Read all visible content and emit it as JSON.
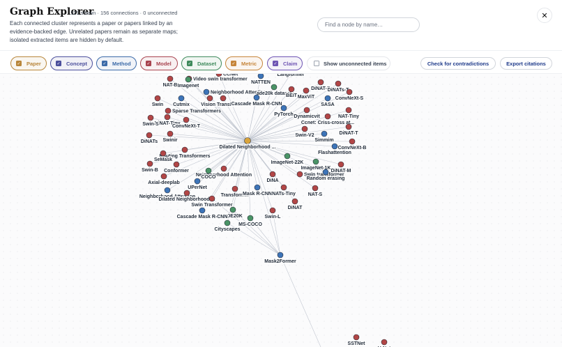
{
  "header": {
    "title": "Graph Explorer",
    "stats": "121 shown · 156 connections · 0 unconnected",
    "description": "Each connected cluster represents a paper or papers linked by an evidence-backed edge. Unrelated papers remain as separate maps; isolated extracted items are hidden by default.",
    "search_placeholder": "Find a node by name…",
    "close_icon": "close-icon"
  },
  "filters": [
    {
      "label": "Paper",
      "color": "#b8863b",
      "checked": true
    },
    {
      "label": "Concept",
      "color": "#4b4f9c",
      "checked": true
    },
    {
      "label": "Method",
      "color": "#3b6aa8",
      "checked": true
    },
    {
      "label": "Model",
      "color": "#a8434f",
      "checked": true
    },
    {
      "label": "Dataset",
      "color": "#3f8a5c",
      "checked": true
    },
    {
      "label": "Metric",
      "color": "#c6853a",
      "checked": true
    },
    {
      "label": "Claim",
      "color": "#6e54b3",
      "checked": true
    }
  ],
  "show_unconnected": {
    "label": "Show unconnected items",
    "checked": false
  },
  "actions": {
    "contradictions": "Check for contradictions",
    "export": "Export citations"
  },
  "colors": {
    "model": "#b24646",
    "method": "#3d74b8",
    "dataset": "#4a9466",
    "paper": "#d9a43c"
  },
  "graph": {
    "hub": "Dilated Neighborhood ...",
    "nodes": [
      {
        "label": "CCNet",
        "type": "model"
      },
      {
        "label": "NAT-B",
        "type": "model"
      },
      {
        "label": "Video swin transformer",
        "type": "model"
      },
      {
        "label": "Imagenet",
        "type": "dataset"
      },
      {
        "label": "NATTEN",
        "type": "method"
      },
      {
        "label": "Langformer",
        "type": "model"
      },
      {
        "label": "DiNAT-B",
        "type": "model"
      },
      {
        "label": "DiNATs-T",
        "type": "model"
      },
      {
        "label": "Neighborhood Attention",
        "type": "method"
      },
      {
        "label": "ade20k dataset",
        "type": "dataset"
      },
      {
        "label": "BEiT",
        "type": "model"
      },
      {
        "label": "MaxViT",
        "type": "model"
      },
      {
        "label": "ConvNeXt-S",
        "type": "model"
      },
      {
        "label": "Swin",
        "type": "model"
      },
      {
        "label": "Cutmix",
        "type": "method"
      },
      {
        "label": "DiNA",
        "type": "model"
      },
      {
        "label": "Vision Transformer",
        "type": "model"
      },
      {
        "label": "Cascade Mask R-CNN",
        "type": "method"
      },
      {
        "label": "SASA",
        "type": "method"
      },
      {
        "label": "Sparse Transformers",
        "type": "model"
      },
      {
        "label": "PyTorch",
        "type": "method"
      },
      {
        "label": "DiNAT-Tiny",
        "type": "model"
      },
      {
        "label": "Dynamicvit",
        "type": "model"
      },
      {
        "label": "NAT-Tiny",
        "type": "model"
      },
      {
        "label": "Swin-S",
        "type": "model"
      },
      {
        "label": "ConvNeXt-T",
        "type": "model"
      },
      {
        "label": "Ccnet: Criss-cross at...",
        "type": "model"
      },
      {
        "label": "Dilated Neighborhood ...",
        "type": "method"
      },
      {
        "label": "DiNAT-T",
        "type": "model"
      },
      {
        "label": "Swin-V2",
        "type": "model"
      },
      {
        "label": "DiNATs",
        "type": "model"
      },
      {
        "label": "Swinir",
        "type": "model"
      },
      {
        "label": "Simmim",
        "type": "method"
      },
      {
        "label": "ConvNeXt-B",
        "type": "model"
      },
      {
        "label": "Routing Transformers",
        "type": "model"
      },
      {
        "label": "Flashattention",
        "type": "method"
      },
      {
        "label": "SeMask",
        "type": "model"
      },
      {
        "label": "ImageNet-22K",
        "type": "dataset"
      },
      {
        "label": "Swin-B",
        "type": "model"
      },
      {
        "label": "Conformer",
        "type": "model"
      },
      {
        "label": "ImageNet-1K",
        "type": "dataset"
      },
      {
        "label": "DiNAT-M",
        "type": "model"
      },
      {
        "label": "Neighborhood Attention",
        "type": "model"
      },
      {
        "label": "COCO",
        "type": "dataset"
      },
      {
        "label": "Axial-deeplab",
        "type": "model"
      },
      {
        "label": "DiNA",
        "type": "model"
      },
      {
        "label": "Swin transformer",
        "type": "model"
      },
      {
        "label": "Random erasing",
        "type": "method"
      },
      {
        "label": "UPerNet",
        "type": "method"
      },
      {
        "label": "Transformer",
        "type": "model"
      },
      {
        "label": "Mask R-CNN",
        "type": "method"
      },
      {
        "label": "NATs-Tiny",
        "type": "model"
      },
      {
        "label": "NAT-S",
        "type": "model"
      },
      {
        "label": "Neighborhood Attention",
        "type": "method"
      },
      {
        "label": "Dilated Neighborhood ...",
        "type": "model"
      },
      {
        "label": "Swin Transformer",
        "type": "model"
      },
      {
        "label": "DiNAT",
        "type": "model"
      },
      {
        "label": "ADE20K",
        "type": "dataset"
      },
      {
        "label": "Cascade Mask R-CNN",
        "type": "method"
      },
      {
        "label": "Swin-L",
        "type": "model"
      },
      {
        "label": "MS-COCO",
        "type": "dataset"
      },
      {
        "label": "Cityscapes",
        "type": "dataset"
      },
      {
        "label": "Mask2Former",
        "type": "method"
      },
      {
        "label": "SSTNet",
        "type": "model"
      },
      {
        "label": "U-Net",
        "type": "model"
      }
    ]
  }
}
